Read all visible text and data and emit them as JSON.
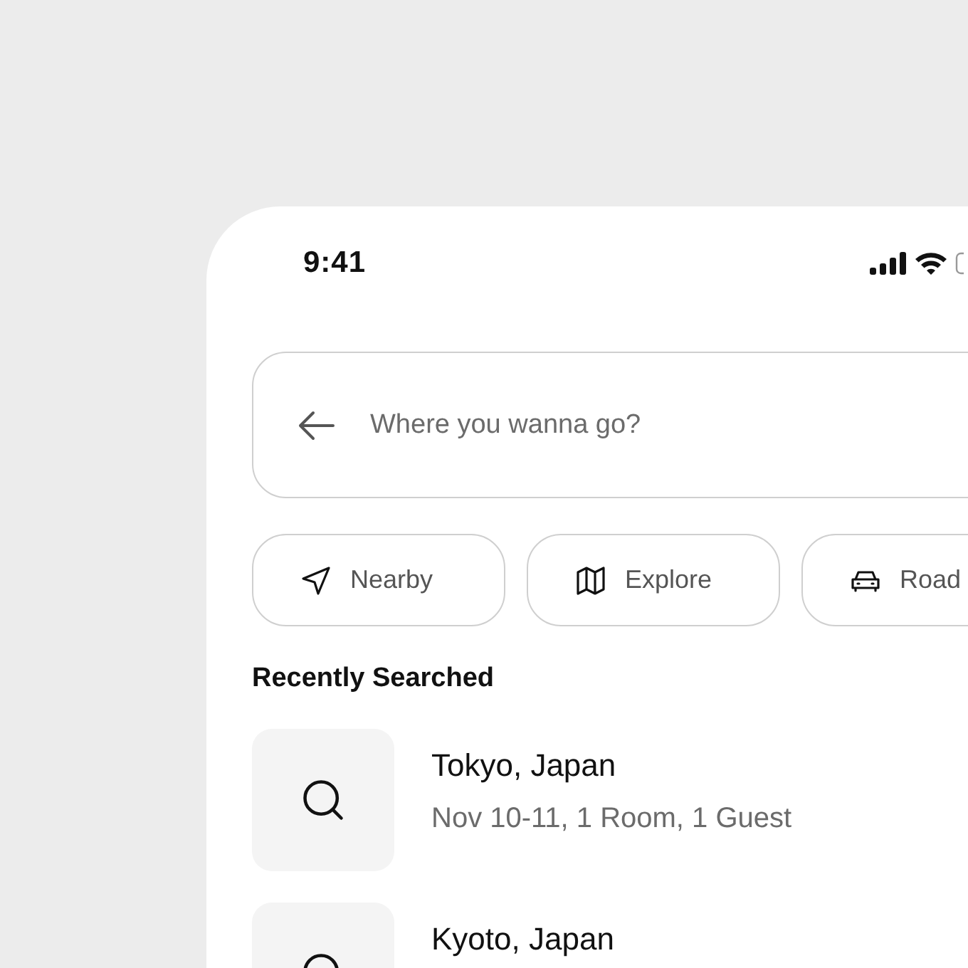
{
  "status_bar": {
    "time": "9:41"
  },
  "search": {
    "placeholder": "Where you wanna go?"
  },
  "chips": [
    {
      "label": "Nearby",
      "kind": "nearby"
    },
    {
      "label": "Explore",
      "kind": "explore"
    },
    {
      "label": "Road",
      "kind": "road"
    }
  ],
  "recent": {
    "title": "Recently Searched",
    "items": [
      {
        "title": "Tokyo, Japan",
        "details": "Nov 10-11, 1 Room, 1 Guest"
      },
      {
        "title": "Kyoto, Japan"
      }
    ]
  }
}
